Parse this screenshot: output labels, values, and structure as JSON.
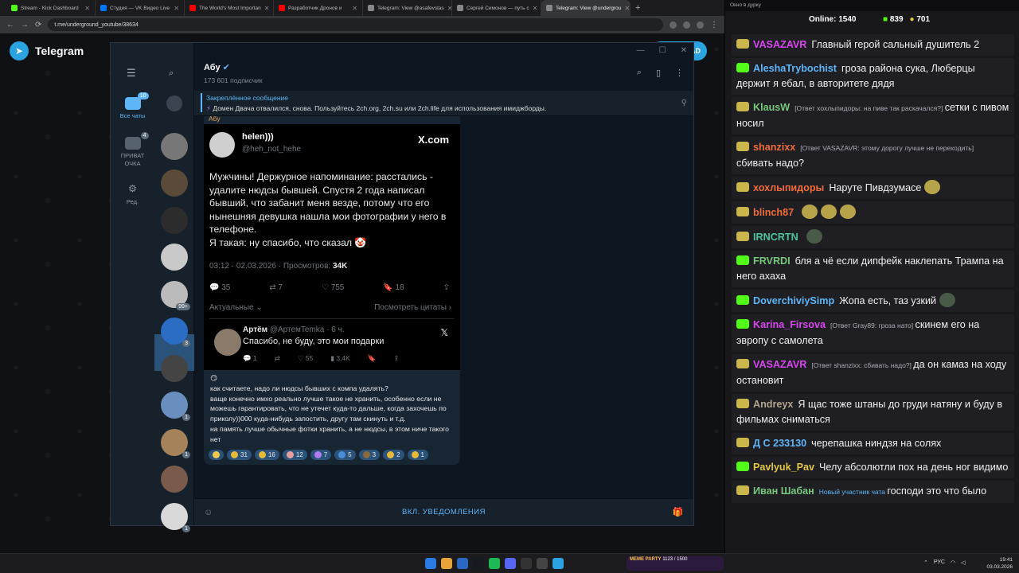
{
  "browser": {
    "tabs": [
      {
        "title": "Stream - Kick Dashboard",
        "color": "#53fc18"
      },
      {
        "title": "Студия — VK Видео Live",
        "color": "#0077ff"
      },
      {
        "title": "The World's Most Importan",
        "color": "#ff0000"
      },
      {
        "title": "Разработчик Дронов и",
        "color": "#ff0000"
      },
      {
        "title": "Telegram: View @asafevstas",
        "color": "#888888"
      },
      {
        "title": "Сергей Симонов — путь с",
        "color": "#888888"
      },
      {
        "title": "Telegram: View @undergrou",
        "color": "#888888",
        "active": true
      }
    ],
    "url": "t.me/underground_youtube/38634"
  },
  "tgpage": {
    "logo": "Telegram",
    "open_btn": "AD"
  },
  "tg": {
    "folders": [
      {
        "label": "Все чаты",
        "badge": "10",
        "active": true
      },
      {
        "label": "ПРИВАТ ОЧКА",
        "badge": "4"
      },
      {
        "label": "Ред.",
        "badge": ""
      }
    ],
    "chat_badges": [
      "",
      "",
      "",
      "",
      "",
      "99+",
      "3",
      "",
      "1",
      "1",
      "",
      "1"
    ],
    "channel": {
      "title": "Абу",
      "subscribers": "173 601 подписчик"
    },
    "pinned": {
      "label": "Закреплённое сообщение",
      "text": "Домен Двача отвалился, снова.  Пользуйтесь 2ch.org, 2ch.su или 2ch.life для использования имиджборды."
    },
    "post": {
      "author": "Абу",
      "tweet": {
        "name": "helen)))",
        "handle": "@heh_not_hehe",
        "brand": "X.com",
        "body": "Мужчины! Держурное напоминание: расстались - удалите нюдсы бывшей. Спустя 2 года написал бывший, что забанит меня везде, потому что его нынешняя девушка нашла мои фотографии у него в телефоне.\nЯ такая: ну спасибо, что сказал",
        "time": "03:12 · 02.03.2026 · Просмотров:",
        "views": "34K",
        "replies": "35",
        "retweets": "7",
        "likes": "755",
        "bookmarks": "18",
        "sort": "Актуальные",
        "quotes": "Посмотреть цитаты"
      },
      "reply": {
        "name": "Артём",
        "handle": "@АртемTemka · 6 ч.",
        "text": "Спасибо, не буду, это мои подарки",
        "replies": "1",
        "likes": "55",
        "views": "3,4K"
      },
      "caption": "как считаете, надо ли нюдсы бывших с компа удалять?\nваще конечно имхо реально лучше такое не хранить, особенно если не можешь гарантировать, что не утечет куда-то дальше, когда захочешь по приколу))000 куда-нибудь запостить, другу там скинуть и т.д.\nна память лучше обычные фотки хранить, а не нюдсы, в этом ниче такого нет",
      "reactions": [
        "",
        "31",
        "16",
        "12",
        "7",
        "5",
        "3",
        "2",
        "1"
      ]
    },
    "bottom": "ВКЛ. УВЕДОМЛЕНИЯ"
  },
  "chat": {
    "header": "Окно в дурку",
    "online_label": "Online:",
    "online": "1540",
    "kicks": "839",
    "subs": "701",
    "messages": [
      {
        "user": "VASAZAVR",
        "color": "#d946ef",
        "badge": "b",
        "reply": "",
        "text": "Главный герой сальный душитель 2"
      },
      {
        "user": "AleshaTrybochist",
        "color": "#5eb5f7",
        "badge": "k",
        "reply": "",
        "text": "гроза района сука, Люберцы держит я ебал, в авторитете дядя"
      },
      {
        "user": "KlausW",
        "color": "#79c67d",
        "badge": "b",
        "reply": "[Ответ хохлыпидоры: на пиве так раскачался?]",
        "text": "сетки с пивом носил"
      },
      {
        "user": "shanzixx",
        "color": "#ef6c3a",
        "badge": "b",
        "reply": "[Ответ VASAZAVR: этому дорогу лучше не переходить]",
        "text": "сбивать надо?"
      },
      {
        "user": "хохлыпидоры",
        "color": "#ef6c3a",
        "badge": "b",
        "reply": "",
        "text": "Наруте Пивдзумасе"
      },
      {
        "user": "blinch87",
        "color": "#ef6c3a",
        "badge": "b",
        "reply": "",
        "text": ""
      },
      {
        "user": "IRNCRTN",
        "color": "#4fc3a1",
        "badge": "b",
        "reply": "",
        "text": ""
      },
      {
        "user": "FRVRDI",
        "color": "#79c67d",
        "badge": "k",
        "reply": "",
        "text": "бля а чё если дипфейк наклепать Трампа на него ахаха"
      },
      {
        "user": "DoverchiviySimp",
        "color": "#5eb5f7",
        "badge": "k",
        "reply": "",
        "text": "Жопа есть, таз узкий"
      },
      {
        "user": "Karina_Firsova",
        "color": "#d946ef",
        "badge": "k",
        "reply": "[Ответ Gray89: гроза нато]",
        "text": "скинем его на эвропу с самолета"
      },
      {
        "user": "VASAZAVR",
        "color": "#d946ef",
        "badge": "b",
        "reply": "[Ответ shanzixx: сбивать надо?]",
        "text": "да он камаз на ходу остановит"
      },
      {
        "user": "Andreyx",
        "color": "#b1a38d",
        "badge": "b",
        "reply": "",
        "text": "Я щас тоже штаны до груди натяну и буду в фильмах сниматься"
      },
      {
        "user": "Д С 233130",
        "color": "#5eb5f7",
        "badge": "b",
        "reply": "",
        "text": "черепашка ниндзя на солях"
      },
      {
        "user": "Pavlyuk_Pav",
        "color": "#e3c744",
        "badge": "k",
        "reply": "",
        "text": "Челу абсолютли пох на день ног видимо"
      },
      {
        "user": "Иван Шабан",
        "color": "#79c67d",
        "badge": "b",
        "reply": "Новый участник чата",
        "text": "господи это что было"
      }
    ]
  },
  "taskbar": {
    "meme": "MEME PARTY",
    "meme_sub": "1123 / 1500",
    "lang": "РУС",
    "time": "19:41",
    "date": "03.03.2026"
  }
}
